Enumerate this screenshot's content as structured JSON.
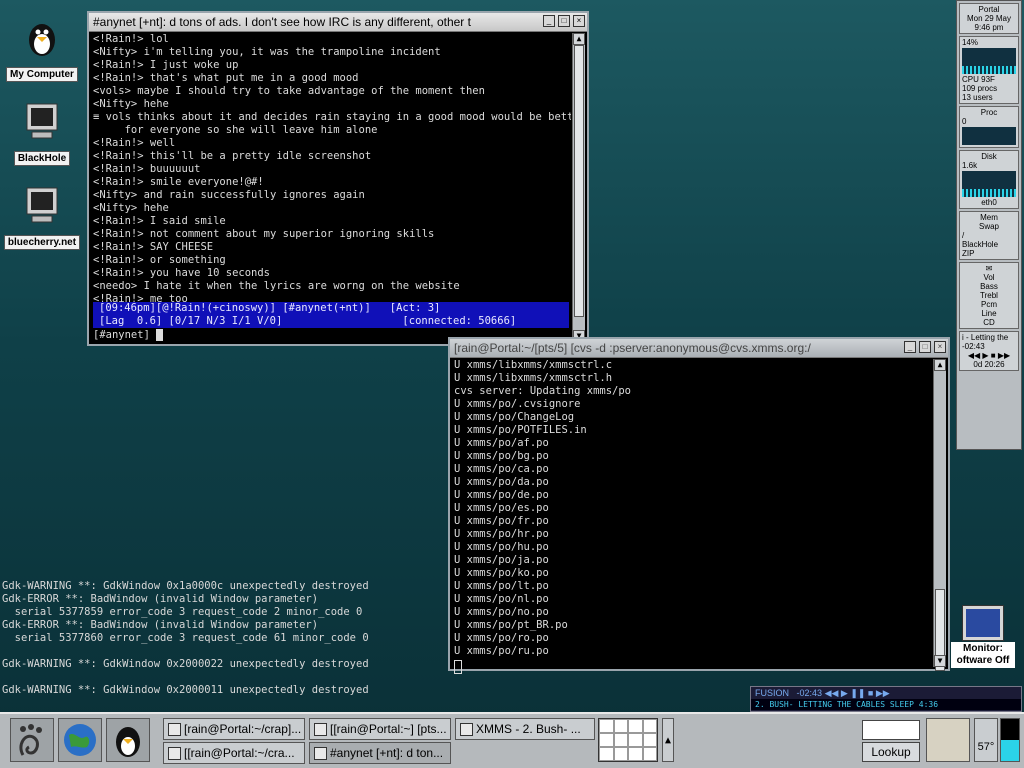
{
  "desktop": {
    "icons": [
      {
        "label": "My Computer"
      },
      {
        "label": "BlackHole"
      },
      {
        "label": "bluecherry.net"
      }
    ]
  },
  "irc_window": {
    "title": "#anynet [+nt]: d tons of ads. I don't see how IRC is any different, other t",
    "lines": [
      "<!Rain!> lol",
      "<Nifty> i'm telling you, it was the trampoline incident",
      "<!Rain!> I just woke up",
      "<!Rain!> that's what put me in a good mood",
      "<vols> maybe I should try to take advantage of the moment then",
      "<Nifty> hehe",
      "≡ vols thinks about it and decides rain staying in a good mood would be better",
      "     for everyone so she will leave him alone",
      "<!Rain!> well",
      "<!Rain!> this'll be a pretty idle screenshot",
      "<!Rain!> buuuuuut",
      "<!Rain!> smile everyone!@#!",
      "<Nifty> and rain successfully ignores again",
      "<Nifty> hehe",
      "<!Rain!> I said smile",
      "<!Rain!> not comment about my superior ignoring skills",
      "<!Rain!> SAY CHEESE",
      "<!Rain!> or something",
      "<!Rain!> you have 10 seconds",
      "<needo> I hate it when the lyrics are worng on the website",
      "<!Rain!> me too"
    ],
    "status1": "[09:46pm][@!Rain!(+cinoswy)] [#anynet(+nt)]   [Act: 3]",
    "status2": "[Lag  0.6] [0/17 N/3 I/1 V/0]                   [connected: 50666]",
    "prompt": "[#anynet] "
  },
  "cvs_window": {
    "title": "[rain@Portal:~/[pts/5] [cvs -d :pserver:anonymous@cvs.xmms.org:/",
    "lines": [
      "U xmms/libxmms/xmmsctrl.c",
      "U xmms/libxmms/xmmsctrl.h",
      "cvs server: Updating xmms/po",
      "U xmms/po/.cvsignore",
      "U xmms/po/ChangeLog",
      "U xmms/po/POTFILES.in",
      "U xmms/po/af.po",
      "U xmms/po/bg.po",
      "U xmms/po/ca.po",
      "U xmms/po/da.po",
      "U xmms/po/de.po",
      "U xmms/po/es.po",
      "U xmms/po/fr.po",
      "U xmms/po/hr.po",
      "U xmms/po/hu.po",
      "U xmms/po/ja.po",
      "U xmms/po/ko.po",
      "U xmms/po/lt.po",
      "U xmms/po/nl.po",
      "U xmms/po/no.po",
      "U xmms/po/pt_BR.po",
      "U xmms/po/ro.po",
      "U xmms/po/ru.po"
    ]
  },
  "error_log": [
    "Gdk-WARNING **: GdkWindow 0x1a0000c unexpectedly destroyed",
    "Gdk-ERROR **: BadWindow (invalid Window parameter)",
    "  serial 5377859 error_code 3 request_code 2 minor_code 0",
    "Gdk-ERROR **: BadWindow (invalid Window parameter)",
    "  serial 5377860 error_code 3 request_code 61 minor_code 0",
    "",
    "Gdk-WARNING **: GdkWindow 0x2000022 unexpectedly destroyed",
    "",
    "Gdk-WARNING **: GdkWindow 0x2000011 unexpectedly destroyed"
  ],
  "dock": {
    "host": "Portal",
    "date": "Mon 29 May",
    "time": "9:46 pm",
    "cpu_pct": "14%",
    "cpu_label": "CPU  93F",
    "procs": "109 procs",
    "users": "13  users",
    "proc_label": "Proc",
    "proc_val": "0",
    "disk_label": "Disk",
    "disk_val": "1.6k",
    "net_label": "eth0",
    "mem_label": "Mem",
    "swap_label": "Swap",
    "fs1": "/",
    "fs2": "BlackHole",
    "fs3": "ZIP",
    "mixer": [
      "Vol",
      "Bass",
      "Trebl",
      "Pcm",
      "Line",
      "CD"
    ],
    "track": "i - Letting the",
    "track_time": "-02:43",
    "uptime": "0d 20:26"
  },
  "monitor": {
    "label": "Monitor: oftware Off"
  },
  "xmms": {
    "top": "FUSION",
    "time": "-02:43",
    "song": "2. BUSH- LETTING THE CABLES SLEEP",
    "len": "4:36"
  },
  "taskbar": {
    "tasks": [
      "[rain@Portal:~/crap]...",
      "[[rain@Portal:~] [pts...",
      "XMMS - 2. Bush- ...",
      "[[rain@Portal:~/cra...",
      "#anynet [+nt]: d ton..."
    ],
    "lookup": "Lookup",
    "temp": "57°"
  }
}
